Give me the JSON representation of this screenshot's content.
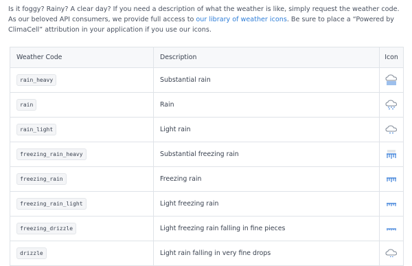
{
  "intro": {
    "text_before_link": "Is it foggy? Rainy? A clear day? If you need a description of what the weather is like, simply request the weather code. As our beloved API consumers, we provide full access to ",
    "link_text": "our library of weather icons",
    "text_after_link": ". Be sure to place a “Powered by ClimaCell” attribution in your application if you use our icons."
  },
  "table": {
    "headers": {
      "code": "Weather Code",
      "description": "Description",
      "icon": "Icon"
    },
    "rows": [
      {
        "code": "rain_heavy",
        "description": "Substantial rain",
        "icon": "cloud-heavy-rain-icon"
      },
      {
        "code": "rain",
        "description": "Rain",
        "icon": "cloud-rain-icon"
      },
      {
        "code": "rain_light",
        "description": "Light rain",
        "icon": "cloud-light-rain-icon"
      },
      {
        "code": "freezing_rain_heavy",
        "description": "Substantial freezing rain",
        "icon": "freezing-rain-heavy-icon"
      },
      {
        "code": "freezing_rain",
        "description": "Freezing rain",
        "icon": "freezing-rain-icon"
      },
      {
        "code": "freezing_rain_light",
        "description": "Light freezing rain",
        "icon": "freezing-rain-light-icon"
      },
      {
        "code": "freezing_drizzle",
        "description": "Light freezing rain falling in fine pieces",
        "icon": "freezing-drizzle-icon"
      },
      {
        "code": "drizzle",
        "description": "Light rain falling in very fine drops",
        "icon": "cloud-drizzle-icon"
      }
    ]
  },
  "colors": {
    "link": "#2f7ed8",
    "icon_blue": "#3b7fd9",
    "icon_gray": "#7b8593",
    "border": "#dfe3e8"
  }
}
